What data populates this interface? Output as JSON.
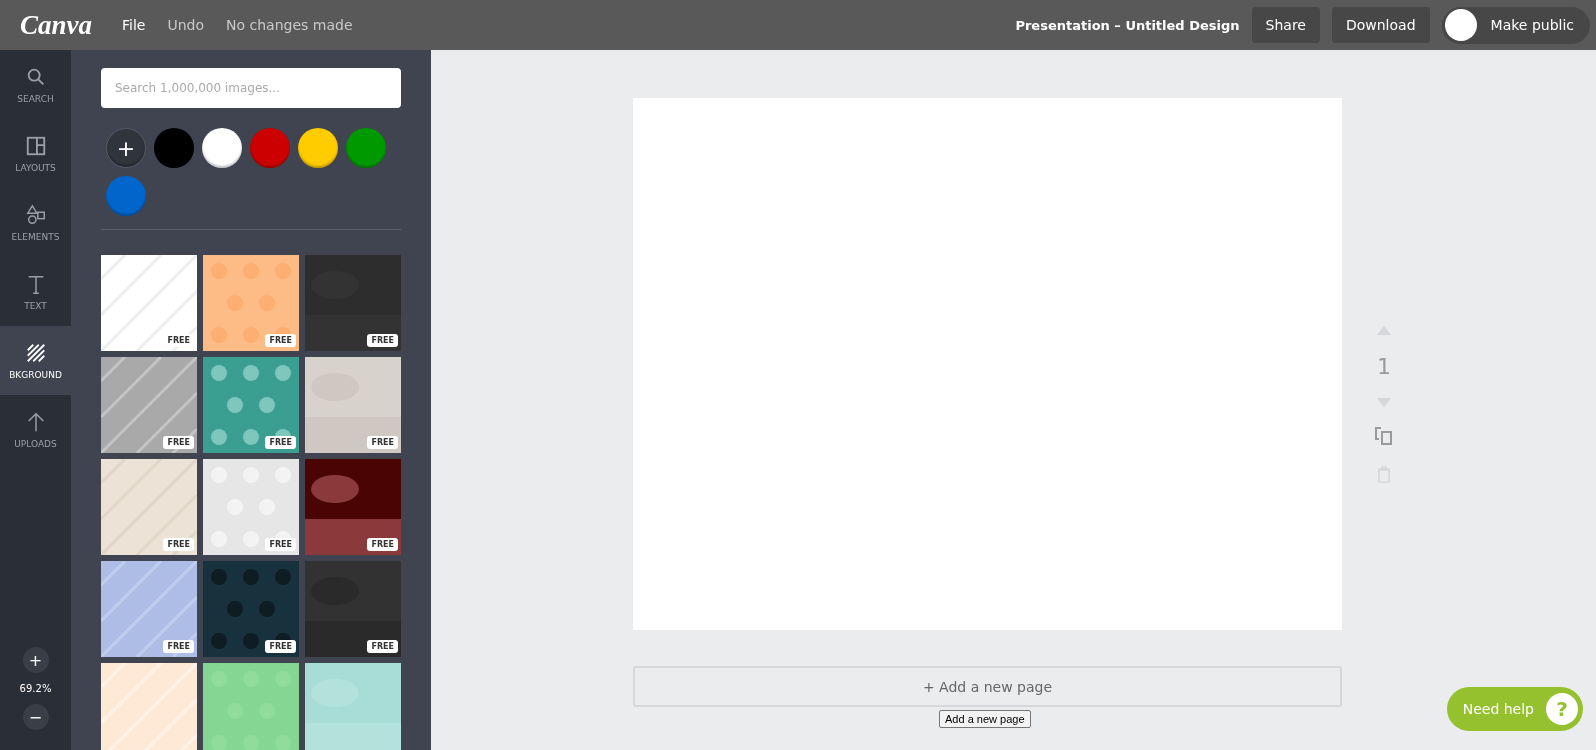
{
  "topbar": {
    "logo": "Canva",
    "menu": [
      {
        "label": "File",
        "kind": "menu"
      },
      {
        "label": "Undo",
        "kind": "action"
      },
      {
        "label": "No changes made",
        "kind": "status"
      }
    ],
    "title": "Presentation – Untitled Design",
    "buttons": [
      "Share",
      "Download"
    ],
    "public_toggle": {
      "label": "Make public",
      "on": false
    }
  },
  "rail": {
    "items": [
      {
        "label": "SEARCH",
        "kind": "search",
        "selected": false
      },
      {
        "label": "LAYOUTS",
        "kind": "layouts",
        "selected": false
      },
      {
        "label": "ELEMENTS",
        "kind": "elements",
        "selected": false
      },
      {
        "label": "TEXT",
        "kind": "text",
        "selected": false
      },
      {
        "label": "BKGROUND",
        "kind": "background",
        "selected": true
      },
      {
        "label": "UPLOADS",
        "kind": "uploads",
        "selected": false
      }
    ],
    "zoom_in": "+",
    "zoom_level": "69.2%",
    "zoom_out": "−"
  },
  "panel": {
    "search": {
      "placeholder": "Search 1,000,000 images..."
    },
    "add_color": "+",
    "colors": [
      {
        "color": "#000000"
      },
      {
        "color": "#ffffff"
      },
      {
        "color": "#cc0000"
      },
      {
        "color": "#ffcc00"
      },
      {
        "color": "#009900"
      },
      {
        "color": "#0066cc"
      }
    ],
    "backgrounds": [
      {
        "kind": "picture",
        "badge": "FREE"
      },
      {
        "kind": "picture",
        "badge": "FREE"
      },
      {
        "kind": "picture",
        "badge": "FREE"
      },
      {
        "kind": "picture",
        "badge": "FREE"
      },
      {
        "kind": "picture",
        "badge": "FREE"
      },
      {
        "kind": "picture",
        "badge": "FREE"
      },
      {
        "kind": "picture",
        "badge": "FREE"
      },
      {
        "kind": "picture",
        "badge": "FREE"
      },
      {
        "kind": "picture",
        "badge": "FREE"
      },
      {
        "kind": "picture",
        "badge": "FREE"
      },
      {
        "kind": "picture",
        "badge": "FREE"
      },
      {
        "kind": "picture",
        "badge": "FREE"
      },
      {
        "kind": "picture"
      },
      {
        "kind": "picture"
      },
      {
        "kind": "picture"
      }
    ]
  },
  "editor": {
    "page_number": "1",
    "add_page": "+ Add a new page",
    "tooltip": "Add a new page"
  },
  "help": {
    "label": "Need help",
    "icon_text": "?"
  }
}
